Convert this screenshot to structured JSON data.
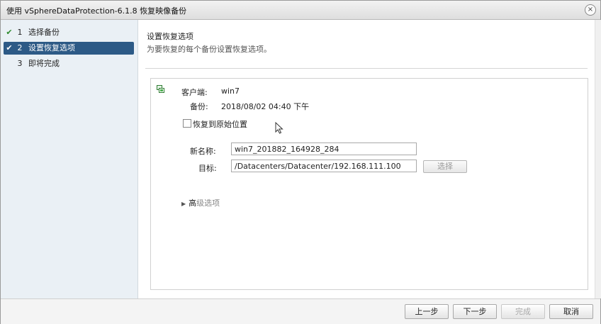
{
  "window": {
    "title": "使用 vSphereDataProtection-6.1.8 恢复映像备份",
    "close_glyph": "×"
  },
  "steps": [
    {
      "num": "1",
      "label": "选择备份",
      "check": "✔"
    },
    {
      "num": "2",
      "label": "设置恢复选项",
      "check": "✔"
    },
    {
      "num": "3",
      "label": "即将完成",
      "check": ""
    }
  ],
  "main": {
    "title": "设置恢复选项",
    "subtitle": "为要恢复的每个备份设置恢复选项。",
    "client_label": "客户端:",
    "client_value": "win7",
    "backup_label": "备份:",
    "backup_value": "2018/08/02 04:40 下午",
    "restore_original_label": "恢复到原始位置",
    "restore_original_checked": false,
    "new_name_label": "新名称:",
    "new_name_value": "win7_201882_164928_284",
    "target_label": "目标:",
    "target_value": "/Datacenters/Datacenter/192.168.111.100",
    "select_button": "选择",
    "advanced_prefix": "高",
    "advanced_rest": "级选项"
  },
  "footer": {
    "back": "上一步",
    "next": "下一步",
    "finish": "完成",
    "cancel": "取消"
  }
}
